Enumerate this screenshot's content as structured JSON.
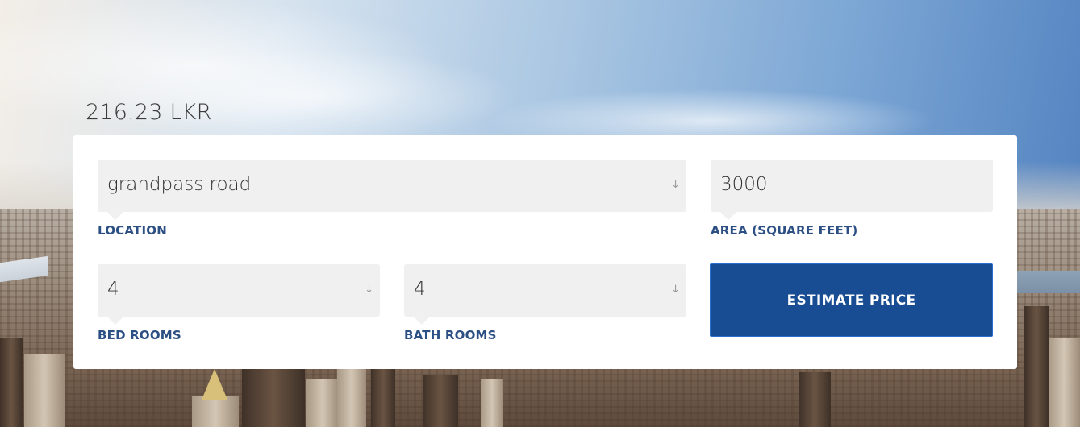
{
  "result": {
    "price_text": "216.23 LKR"
  },
  "form": {
    "location": {
      "value": "grandpass road",
      "label": "LOCATION",
      "arrow": "↓"
    },
    "area": {
      "value": "3000",
      "label": "AREA (SQUARE FEET)"
    },
    "bedrooms": {
      "value": "4",
      "label": "BED ROOMS",
      "arrow": "↓"
    },
    "bathrooms": {
      "value": "4",
      "label": "BATH ROOMS",
      "arrow": "↓"
    },
    "submit_label": "ESTIMATE PRICE"
  },
  "colors": {
    "accent": "#184c93",
    "label": "#2c4f84",
    "field_bg": "#f0f0f0"
  }
}
